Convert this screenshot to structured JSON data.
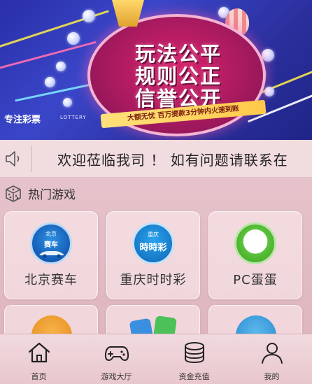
{
  "banner": {
    "headline_lines": [
      "玩法公平",
      "规则公正",
      "信誉公开"
    ],
    "ribbon": "大额无忧 百万提款3分钟内火速到账",
    "brand": "专注彩票",
    "brand_en": "LOTTERY"
  },
  "notice": {
    "text": "欢迎莅临我司 ！ 如有问题请联系在"
  },
  "hot_games": {
    "title": "热门游戏",
    "games": [
      {
        "name": "北京赛车",
        "icon": "beijing-racing-icon",
        "icon_text": "赛车",
        "icon_small": "北京"
      },
      {
        "name": "重庆时时彩",
        "icon": "chongqing-ssc-icon",
        "icon_text": "時時彩",
        "icon_small": "重庆"
      },
      {
        "name": "PC蛋蛋",
        "icon": "pc-egg-icon"
      }
    ]
  },
  "tabbar": {
    "items": [
      {
        "label": "首页",
        "icon": "home-icon"
      },
      {
        "label": "游戏大厅",
        "icon": "gamepad-icon"
      },
      {
        "label": "资金充值",
        "icon": "coins-icon"
      },
      {
        "label": "我的",
        "icon": "user-icon"
      }
    ]
  },
  "colors": {
    "banner_blue": "#2a2fa8",
    "circle_pink": "#d8226c",
    "page_bg": "#ecd0d6",
    "text_dark": "#333333"
  }
}
